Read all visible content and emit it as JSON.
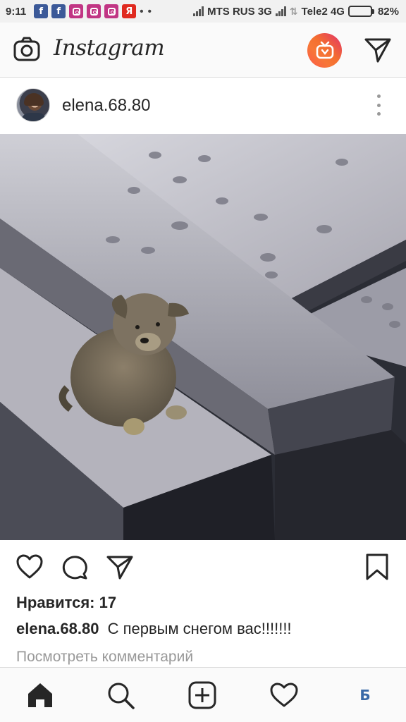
{
  "status_bar": {
    "time": "9:11",
    "notification_icons": [
      "facebook-icon",
      "facebook-icon",
      "instagram-icon",
      "instagram-icon",
      "instagram-icon",
      "yandex-icon"
    ],
    "more_indicator": "• •",
    "carrier1": "MTS RUS 3G",
    "carrier2": "Tele2 4G",
    "battery_percent": "82%",
    "battery_level": 0.82
  },
  "header": {
    "app_title": "Instagram",
    "accent_gradient": [
      "#fd5949",
      "#e1306c"
    ]
  },
  "post": {
    "username": "elena.68.80",
    "likes_text": "Нравится: 17",
    "caption_user": "elena.68.80",
    "caption_text": "С первым снегом вас!!!!!!!",
    "view_comments": "Посмотреть комментарий"
  },
  "bottom_nav": {
    "items": [
      "home-icon",
      "search-icon",
      "add-post-icon",
      "activity-icon",
      "profile-icon"
    ],
    "profile_badge": "Б"
  },
  "colors": {
    "text": "#262626",
    "muted": "#999999",
    "border": "#dbdbdb"
  }
}
